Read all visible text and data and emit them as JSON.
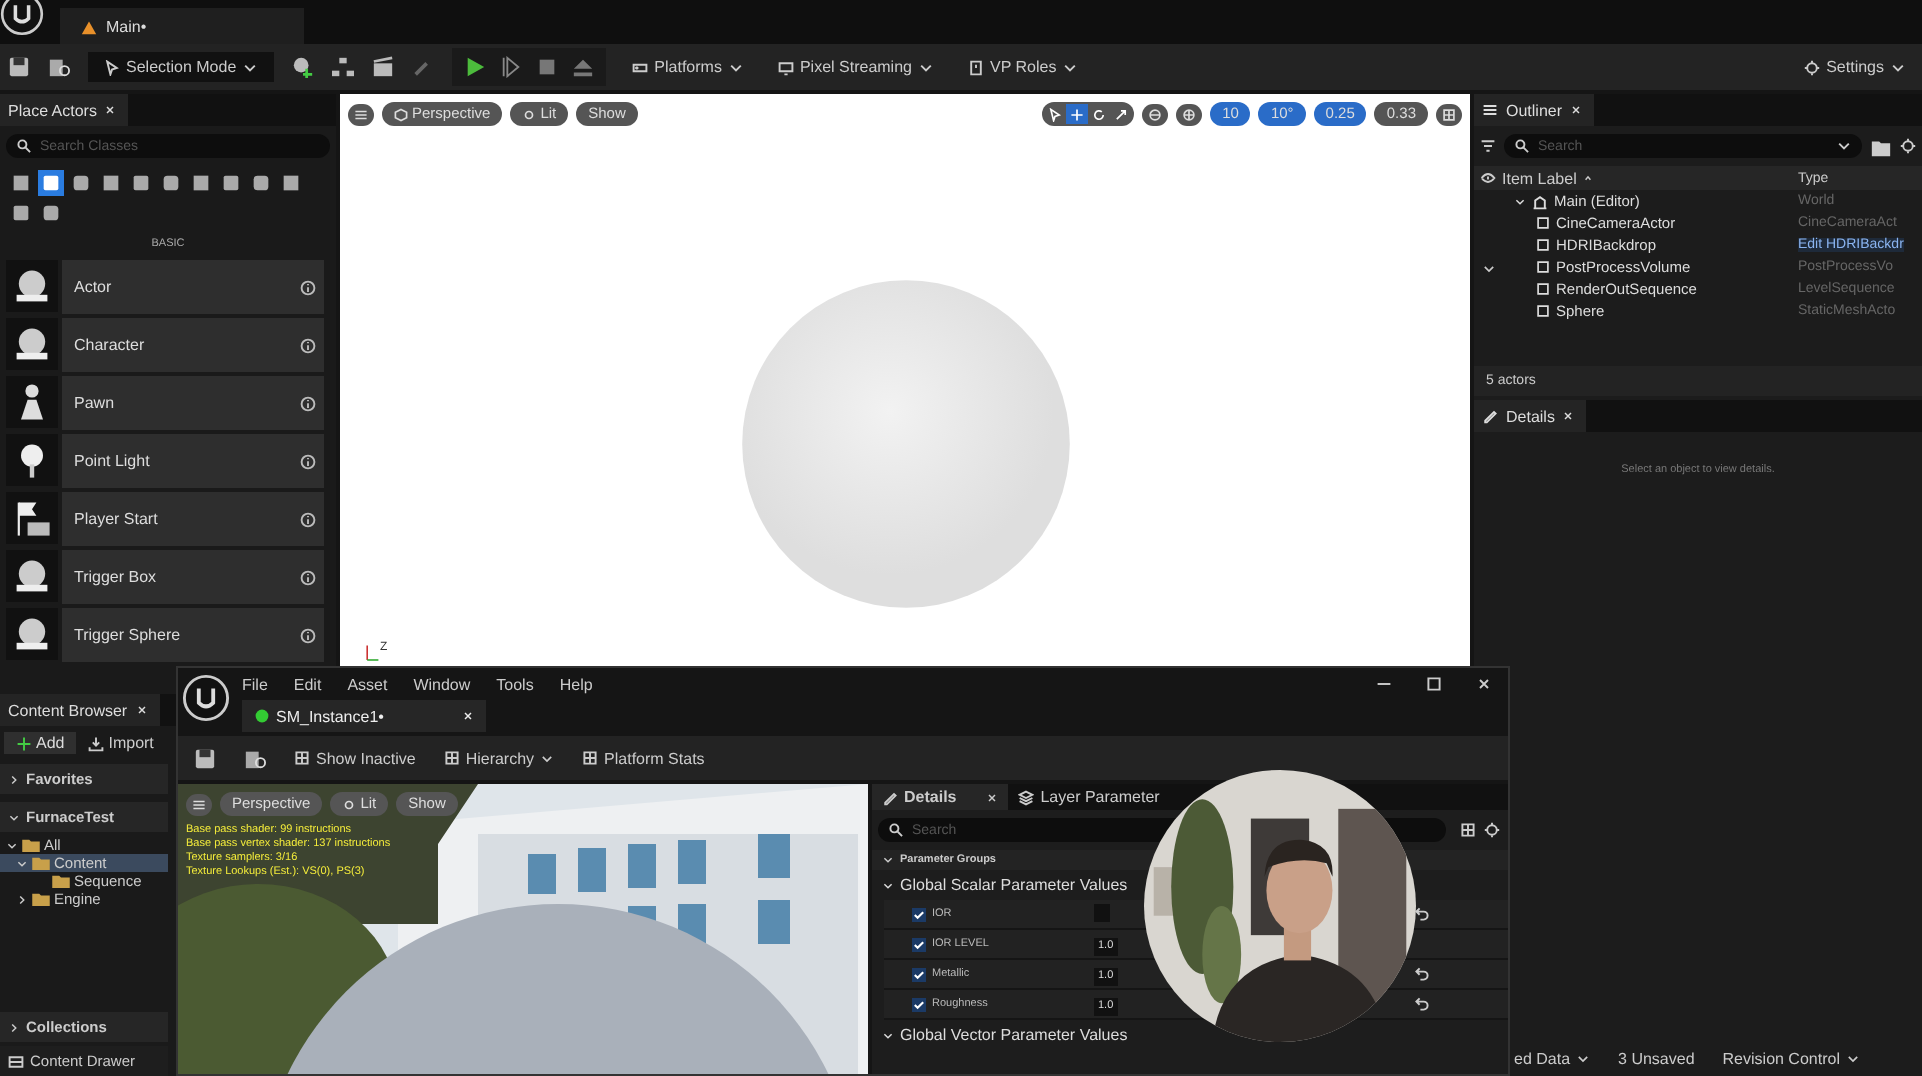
{
  "title_bar": {
    "tab": "Main•"
  },
  "toolbar": {
    "selection_mode": "Selection Mode",
    "platforms": "Platforms",
    "pixel_streaming": "Pixel Streaming",
    "vp_roles": "VP Roles",
    "settings": "Settings"
  },
  "place_actors": {
    "title": "Place Actors",
    "search_placeholder": "Search Classes",
    "section": "BASIC",
    "categories": [
      {
        "selected": false
      },
      {
        "selected": true
      },
      {
        "selected": false
      },
      {
        "selected": false
      },
      {
        "selected": false
      },
      {
        "selected": false
      },
      {
        "selected": false
      },
      {
        "selected": false
      },
      {
        "selected": false
      },
      {
        "selected": false
      },
      {
        "selected": false
      },
      {
        "selected": false
      }
    ],
    "items": [
      {
        "label": "Actor"
      },
      {
        "label": "Character"
      },
      {
        "label": "Pawn"
      },
      {
        "label": "Point Light"
      },
      {
        "label": "Player Start"
      },
      {
        "label": "Trigger Box"
      },
      {
        "label": "Trigger Sphere"
      }
    ]
  },
  "viewport": {
    "perspective": "Perspective",
    "lit": "Lit",
    "show": "Show",
    "axis_label": "Z",
    "transform_modes": [
      {
        "selected": false
      },
      {
        "selected": true
      },
      {
        "selected": false
      },
      {
        "selected": false
      }
    ],
    "snaps": [
      {
        "value": "10",
        "on": true
      },
      {
        "value": "10°",
        "on": true
      },
      {
        "value": "0.25",
        "on": true
      },
      {
        "value": "0.33",
        "on": false
      }
    ]
  },
  "outliner": {
    "title": "Outliner",
    "search_placeholder": "Search",
    "col_label": "Item Label",
    "col_type": "Type",
    "count": "5 actors",
    "rows": [
      {
        "label": "Main (Editor)",
        "type": "World",
        "expanded": true,
        "children": [
          {
            "label": "CineCameraActor",
            "type": "CineCameraAct",
            "type_link": false,
            "chevron": false
          },
          {
            "label": "HDRIBackdrop",
            "type": "Edit HDRIBackdr",
            "type_link": true,
            "chevron": false
          },
          {
            "label": "PostProcessVolume",
            "type": "PostProcessVo",
            "type_link": false,
            "chevron": true
          },
          {
            "label": "RenderOutSequence",
            "type": "LevelSequence",
            "type_link": false,
            "chevron": false
          },
          {
            "label": "Sphere",
            "type": "StaticMeshActo",
            "type_link": false,
            "chevron": false
          }
        ]
      }
    ]
  },
  "details": {
    "title": "Details",
    "empty_message": "Select an object to view details."
  },
  "content_browser": {
    "title": "Content Browser",
    "add": "Add",
    "import": "Import",
    "sections": [
      {
        "label": "Favorites",
        "expanded": false
      },
      {
        "label": "FurnaceTest",
        "expanded": true
      }
    ],
    "tree": [
      {
        "label": "All",
        "expanded": true,
        "selected": false,
        "children": [
          {
            "label": "Content",
            "expanded": true,
            "selected": true,
            "children": [
              {
                "label": "Sequence",
                "selected": false
              }
            ]
          },
          {
            "label": "Engine",
            "expanded": false,
            "selected": false
          }
        ]
      }
    ],
    "collections": "Collections"
  },
  "status_bar": {
    "content_drawer": "Content Drawer",
    "items": [
      {
        "label": "ed Data",
        "dropdown": true
      },
      {
        "label": "3 Unsaved",
        "dropdown": false
      },
      {
        "label": "Revision Control",
        "dropdown": true
      }
    ]
  },
  "material_editor": {
    "menu": [
      "File",
      "Edit",
      "Asset",
      "Window",
      "Tools",
      "Help"
    ],
    "tab": "SM_Instance1•",
    "toolbar": [
      {
        "label": "Show Inactive",
        "dropdown": false
      },
      {
        "label": "Hierarchy",
        "dropdown": true
      },
      {
        "label": "Platform Stats",
        "dropdown": false
      }
    ],
    "viewport": {
      "perspective": "Perspective",
      "lit": "Lit",
      "show": "Show",
      "stats": [
        "Base pass shader: 99 instructions",
        "Base pass vertex shader: 137 instructions",
        "Texture samplers: 3/16",
        "Texture Lookups (Est.): VS(0), PS(3)"
      ]
    },
    "details": {
      "tabs": [
        {
          "label": "Details",
          "selected": true
        },
        {
          "label": "Layer Parameter",
          "selected": false
        }
      ],
      "search_placeholder": "Search",
      "parameter_groups": "Parameter Groups",
      "groups": [
        {
          "label": "Global Scalar Parameter Values",
          "expanded": true,
          "params": [
            {
              "name": "IOR",
              "checked": true,
              "reset": true
            },
            {
              "name": "IOR LEVEL",
              "checked": true,
              "value": "1.0",
              "reset": false
            },
            {
              "name": "Metallic",
              "checked": true,
              "value": "1.0",
              "reset": true
            },
            {
              "name": "Roughness",
              "checked": true,
              "value": "1.0",
              "reset": true
            }
          ]
        },
        {
          "label": "Global Vector Parameter Values",
          "expanded": true
        }
      ]
    }
  }
}
